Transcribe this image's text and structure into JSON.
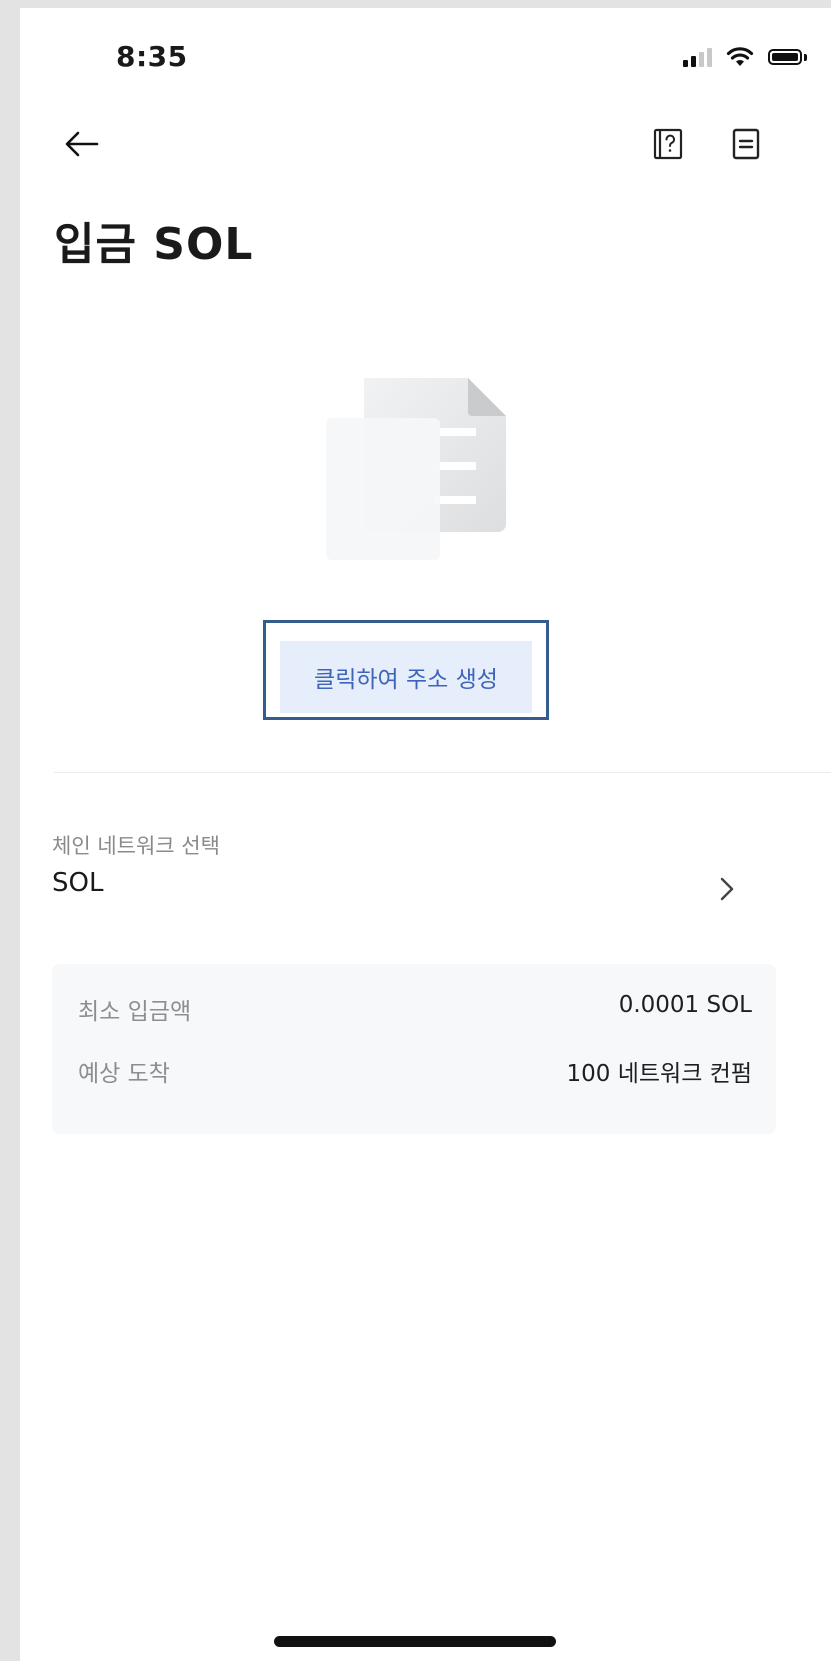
{
  "status_bar": {
    "time": "8:35",
    "icons": [
      "signal-icon",
      "wifi-icon",
      "battery-icon"
    ]
  },
  "nav": {
    "back_icon": "arrow-left-icon",
    "help_icon": "help-book-icon",
    "records_icon": "records-icon"
  },
  "page": {
    "title": "입금 SOL"
  },
  "empty_state": {
    "illustration": "document-copy-icon",
    "generate_button_label": "클릭하여 주소 생성"
  },
  "network": {
    "label": "체인 네트워크 선택",
    "value": "SOL"
  },
  "info": {
    "rows": [
      {
        "key": "최소 입금액",
        "value": "0.0001 SOL"
      },
      {
        "key": "예상 도착",
        "value": "100 네트워크 컨펌"
      }
    ]
  },
  "colors": {
    "accent_text": "#3d64b8",
    "accent_bg": "#e6eefb",
    "highlight_border": "#345d8e",
    "card_bg": "#f7f8f9"
  }
}
